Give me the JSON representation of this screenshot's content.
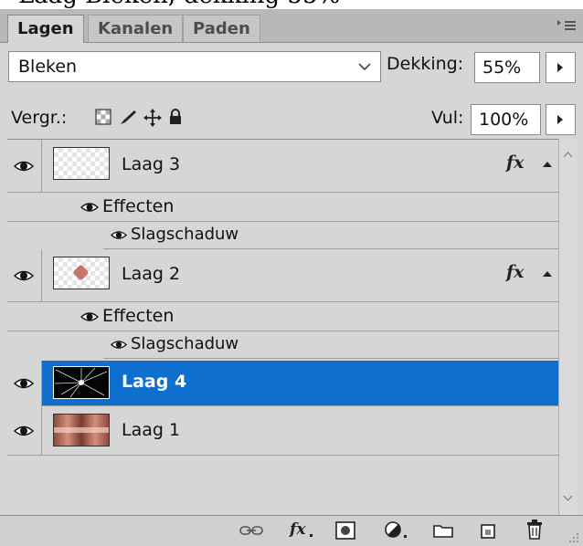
{
  "tabs": [
    {
      "label": "Lagen",
      "active": true
    },
    {
      "label": "Kanalen",
      "active": false
    },
    {
      "label": "Paden",
      "active": false
    }
  ],
  "panel_menu_icon": "panel-menu-icon",
  "blend_mode": {
    "value": "Bleken"
  },
  "opacity": {
    "label": "Dekking:",
    "value": "55%"
  },
  "lock": {
    "label": "Vergr.:",
    "icons": [
      "lock-transparency-icon",
      "lock-paint-icon",
      "lock-position-icon",
      "lock-all-icon"
    ]
  },
  "fill": {
    "label": "Vul:",
    "value": "100%"
  },
  "layers": [
    {
      "name": "Laag 3",
      "has_fx": true,
      "effects_label": "Effecten",
      "effect": "Slagschaduw",
      "selected": false
    },
    {
      "name": "Laag 2",
      "has_fx": true,
      "effects_label": "Effecten",
      "effect": "Slagschaduw",
      "selected": false
    },
    {
      "name": "Laag 4",
      "has_fx": false,
      "selected": true
    },
    {
      "name": "Laag 1",
      "has_fx": false,
      "selected": false
    }
  ],
  "fx_label": "fx",
  "colors": {
    "selection": "#0f6fce",
    "panel": "#d6d6d6"
  },
  "bottom_icons": [
    "link-layers-icon",
    "add-style-icon",
    "add-mask-icon",
    "adjustment-layer-icon",
    "new-group-icon",
    "new-layer-icon",
    "delete-layer-icon"
  ]
}
